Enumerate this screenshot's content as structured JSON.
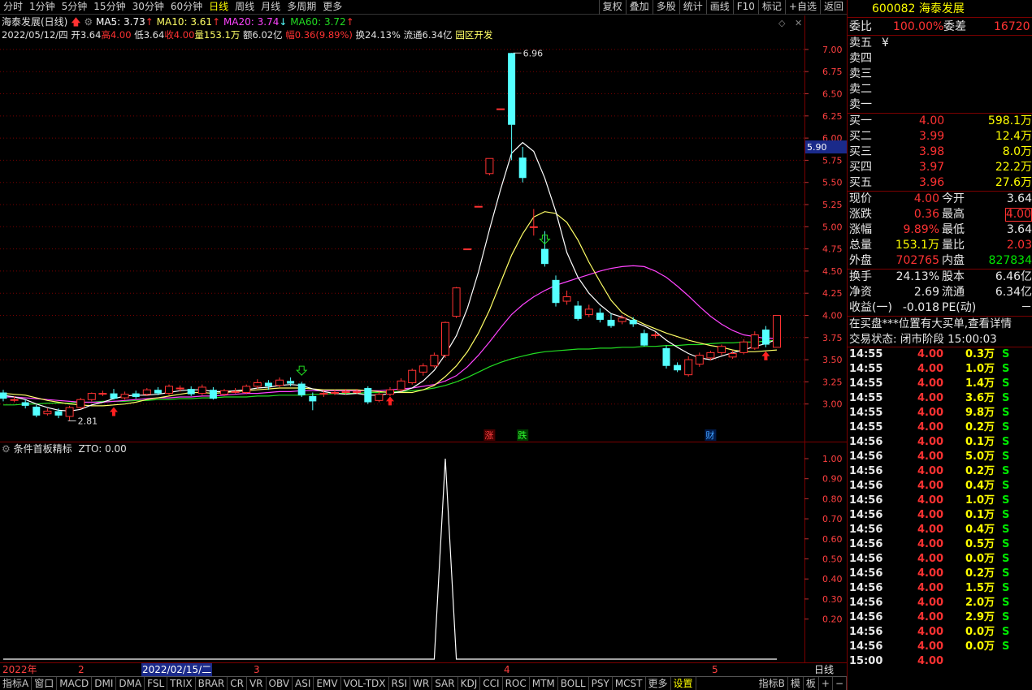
{
  "toolbar": {
    "periods": [
      "分时",
      "1分钟",
      "5分钟",
      "15分钟",
      "30分钟",
      "60分钟",
      "日线",
      "周线",
      "月线",
      "多周期",
      "更多"
    ],
    "active_period": "日线",
    "right_buttons": [
      "复权",
      "叠加",
      "多股",
      "统计",
      "画线",
      "F10",
      "标记",
      "+自选",
      "返回"
    ]
  },
  "header": {
    "title": "海泰发展(日线)",
    "ma5": "MA5: 3.73",
    "ma10": "MA10: 3.61",
    "ma20": "MA20: 3.74",
    "ma60": "MA60: 3.72",
    "date": "2022/05/12/四",
    "open": "开3.64",
    "high": "高4.00",
    "low": "低3.64",
    "close": "收4.00",
    "volume": "量153.1万",
    "amount": "额6.02亿",
    "change": "幅0.36(9.89%)",
    "turnover": "换24.13%",
    "float": "流通6.34亿",
    "sector": "园区开发"
  },
  "colors": {
    "up": "#ff3232",
    "down": "#54ffff",
    "ma5": "#ffffff",
    "ma10": "#ffff66",
    "ma20": "#ff44ff",
    "ma60": "#22dd22",
    "grid": "#7a0000"
  },
  "price_axis": {
    "ticks": [
      "7.00",
      "6.75",
      "6.50",
      "6.25",
      "6.00",
      "5.75",
      "5.50",
      "5.25",
      "5.00",
      "4.75",
      "4.50",
      "4.25",
      "4.00",
      "3.75",
      "3.50",
      "3.25",
      "3.00"
    ],
    "cursor_label": "5.90",
    "max_label": "6.96",
    "min_label": "2.81",
    "event_labels": [
      "涨",
      "跌",
      "财"
    ]
  },
  "indicator": {
    "title": "条件首板精标",
    "value": "ZTO: 0.00",
    "ticks": [
      "1.00",
      "0.90",
      "0.80",
      "0.70",
      "0.60",
      "0.50",
      "0.40",
      "0.30",
      "0.20"
    ]
  },
  "date_axis": {
    "labels": [
      "2022年",
      "2",
      "2022/02/15/二",
      "3",
      "4",
      "5"
    ],
    "right_label": "日线"
  },
  "bottom_tabs": [
    "指标A",
    "窗口",
    "MACD",
    "DMI",
    "DMA",
    "FSL",
    "TRIX",
    "BRAR",
    "CR",
    "VR",
    "OBV",
    "ASI",
    "EMV",
    "VOL-TDX",
    "RSI",
    "WR",
    "SAR",
    "KDJ",
    "CCI",
    "ROC",
    "MTM",
    "BOLL",
    "PSY",
    "MCST",
    "更多",
    "设置"
  ],
  "bottom_right": [
    "指标B",
    "模",
    "板"
  ],
  "quote": {
    "code": "600082",
    "name": "海泰发展",
    "weibi_label": "委比",
    "weibi": "100.00%",
    "weicha_label": "委差",
    "weicha": "16720",
    "sell": [
      {
        "label": "卖五",
        "extra": "¥"
      },
      {
        "label": "卖四",
        "extra": ""
      },
      {
        "label": "卖三",
        "extra": ""
      },
      {
        "label": "卖二",
        "extra": ""
      },
      {
        "label": "卖一",
        "extra": ""
      }
    ],
    "buy": [
      {
        "label": "买一",
        "price": "4.00",
        "vol": "598.1万"
      },
      {
        "label": "买二",
        "price": "3.99",
        "vol": "12.4万"
      },
      {
        "label": "买三",
        "price": "3.98",
        "vol": "8.0万"
      },
      {
        "label": "买四",
        "price": "3.97",
        "vol": "22.2万"
      },
      {
        "label": "买五",
        "price": "3.96",
        "vol": "27.6万"
      }
    ],
    "stats": [
      {
        "l1": "现价",
        "v1": "4.00",
        "l2": "今开",
        "v2": "3.64"
      },
      {
        "l1": "涨跌",
        "v1": "0.36",
        "l2": "最高",
        "v2": "4.00"
      },
      {
        "l1": "涨幅",
        "v1": "9.89%",
        "l2": "最低",
        "v2": "3.64"
      },
      {
        "l1": "总量",
        "v1": "153.1万",
        "l2": "量比",
        "v2": "2.03"
      },
      {
        "l1": "外盘",
        "v1": "702765",
        "l2": "内盘",
        "v2": "827834"
      }
    ],
    "stats2": [
      {
        "l1": "换手",
        "v1": "24.13%",
        "l2": "股本",
        "v2": "6.46亿"
      },
      {
        "l1": "净资",
        "v1": "2.69",
        "l2": "流通",
        "v2": "6.34亿"
      },
      {
        "l1": "收益(一)",
        "v1": "-0.018",
        "l2": "PE(动)",
        "v2": "－"
      }
    ],
    "notice": "在买盘***位置有大买单,查看详情",
    "status": "交易状态: 闭市阶段 15:00:03",
    "ticks": [
      {
        "t": "14:55",
        "p": "4.00",
        "v": "0.3万",
        "s": "S"
      },
      {
        "t": "14:55",
        "p": "4.00",
        "v": "1.0万",
        "s": "S"
      },
      {
        "t": "14:55",
        "p": "4.00",
        "v": "1.4万",
        "s": "S"
      },
      {
        "t": "14:55",
        "p": "4.00",
        "v": "3.6万",
        "s": "S"
      },
      {
        "t": "14:55",
        "p": "4.00",
        "v": "9.8万",
        "s": "S"
      },
      {
        "t": "14:55",
        "p": "4.00",
        "v": "0.2万",
        "s": "S"
      },
      {
        "t": "14:56",
        "p": "4.00",
        "v": "0.1万",
        "s": "S"
      },
      {
        "t": "14:56",
        "p": "4.00",
        "v": "5.0万",
        "s": "S"
      },
      {
        "t": "14:56",
        "p": "4.00",
        "v": "0.2万",
        "s": "S"
      },
      {
        "t": "14:56",
        "p": "4.00",
        "v": "0.4万",
        "s": "S"
      },
      {
        "t": "14:56",
        "p": "4.00",
        "v": "1.0万",
        "s": "S"
      },
      {
        "t": "14:56",
        "p": "4.00",
        "v": "0.1万",
        "s": "S"
      },
      {
        "t": "14:56",
        "p": "4.00",
        "v": "0.4万",
        "s": "S"
      },
      {
        "t": "14:56",
        "p": "4.00",
        "v": "0.5万",
        "s": "S"
      },
      {
        "t": "14:56",
        "p": "4.00",
        "v": "0.0万",
        "s": "S"
      },
      {
        "t": "14:56",
        "p": "4.00",
        "v": "0.2万",
        "s": "S"
      },
      {
        "t": "14:56",
        "p": "4.00",
        "v": "1.5万",
        "s": "S"
      },
      {
        "t": "14:56",
        "p": "4.00",
        "v": "2.0万",
        "s": "S"
      },
      {
        "t": "14:56",
        "p": "4.00",
        "v": "2.9万",
        "s": "S"
      },
      {
        "t": "14:56",
        "p": "4.00",
        "v": "0.0万",
        "s": "S"
      },
      {
        "t": "14:56",
        "p": "4.00",
        "v": "0.0万",
        "s": "S"
      },
      {
        "t": "15:00",
        "p": "4.00",
        "v": "",
        "s": ""
      }
    ]
  },
  "chart_data": {
    "type": "candlestick",
    "ylim": [
      2.75,
      7.1
    ],
    "candles": [
      {
        "o": 3.13,
        "c": 3.06,
        "h": 3.16,
        "l": 3.03
      },
      {
        "o": 3.05,
        "c": 3.05,
        "h": 3.09,
        "l": 3.02
      },
      {
        "o": 3.02,
        "c": 2.98,
        "h": 3.05,
        "l": 2.95
      },
      {
        "o": 2.97,
        "c": 2.87,
        "h": 2.99,
        "l": 2.85
      },
      {
        "o": 2.89,
        "c": 2.92,
        "h": 2.95,
        "l": 2.87
      },
      {
        "o": 2.92,
        "c": 2.87,
        "h": 2.95,
        "l": 2.84
      },
      {
        "o": 2.86,
        "c": 2.96,
        "h": 2.98,
        "l": 2.81
      },
      {
        "o": 2.96,
        "c": 3.05,
        "h": 3.07,
        "l": 2.94
      },
      {
        "o": 3.05,
        "c": 3.12,
        "h": 3.13,
        "l": 3.03
      },
      {
        "o": 3.12,
        "c": 3.12,
        "h": 3.15,
        "l": 3.09
      },
      {
        "o": 3.12,
        "c": 3.06,
        "h": 3.17,
        "l": 3.05
      },
      {
        "o": 3.07,
        "c": 3.11,
        "h": 3.14,
        "l": 3.05
      },
      {
        "o": 3.12,
        "c": 3.08,
        "h": 3.15,
        "l": 3.06
      },
      {
        "o": 3.11,
        "c": 3.16,
        "h": 3.18,
        "l": 3.09
      },
      {
        "o": 3.16,
        "c": 3.12,
        "h": 3.19,
        "l": 3.1
      },
      {
        "o": 3.12,
        "c": 3.2,
        "h": 3.22,
        "l": 3.1
      },
      {
        "o": 3.18,
        "c": 3.18,
        "h": 3.21,
        "l": 3.14
      },
      {
        "o": 3.17,
        "c": 3.11,
        "h": 3.2,
        "l": 3.09
      },
      {
        "o": 3.12,
        "c": 3.19,
        "h": 3.22,
        "l": 3.1
      },
      {
        "o": 3.16,
        "c": 3.06,
        "h": 3.19,
        "l": 3.05
      },
      {
        "o": 3.11,
        "c": 3.15,
        "h": 3.17,
        "l": 3.09
      },
      {
        "o": 3.14,
        "c": 3.14,
        "h": 3.18,
        "l": 3.12
      },
      {
        "o": 3.13,
        "c": 3.2,
        "h": 3.22,
        "l": 3.11
      },
      {
        "o": 3.2,
        "c": 3.24,
        "h": 3.28,
        "l": 3.17
      },
      {
        "o": 3.24,
        "c": 3.2,
        "h": 3.27,
        "l": 3.16
      },
      {
        "o": 3.21,
        "c": 3.27,
        "h": 3.3,
        "l": 3.19
      },
      {
        "o": 3.26,
        "c": 3.23,
        "h": 3.3,
        "l": 3.2
      },
      {
        "o": 3.23,
        "c": 3.1,
        "h": 3.25,
        "l": 3.08
      },
      {
        "o": 3.09,
        "c": 3.03,
        "h": 3.13,
        "l": 2.93
      },
      {
        "o": 3.11,
        "c": 3.12,
        "h": 3.15,
        "l": 3.08
      },
      {
        "o": 3.13,
        "c": 3.13,
        "h": 3.16,
        "l": 3.1
      },
      {
        "o": 3.13,
        "c": 3.14,
        "h": 3.17,
        "l": 3.11
      },
      {
        "o": 3.13,
        "c": 3.14,
        "h": 3.17,
        "l": 3.11
      },
      {
        "o": 3.18,
        "c": 3.02,
        "h": 3.2,
        "l": 3.0
      },
      {
        "o": 3.04,
        "c": 3.11,
        "h": 3.14,
        "l": 3.02
      },
      {
        "o": 3.11,
        "c": 3.16,
        "h": 3.19,
        "l": 3.09
      },
      {
        "o": 3.16,
        "c": 3.26,
        "h": 3.29,
        "l": 3.14
      },
      {
        "o": 3.24,
        "c": 3.38,
        "h": 3.4,
        "l": 3.22
      },
      {
        "o": 3.36,
        "c": 3.43,
        "h": 3.46,
        "l": 3.32
      },
      {
        "o": 3.43,
        "c": 3.55,
        "h": 3.58,
        "l": 3.41
      },
      {
        "o": 3.55,
        "c": 3.92,
        "h": 3.93,
        "l": 3.52
      },
      {
        "o": 3.99,
        "c": 4.31,
        "h": 4.32,
        "l": 3.97
      },
      {
        "o": 4.75,
        "c": 4.75,
        "h": 4.75,
        "l": 4.75
      },
      {
        "o": 5.23,
        "c": 5.23,
        "h": 5.23,
        "l": 5.23
      },
      {
        "o": 5.6,
        "c": 5.77,
        "h": 5.77,
        "l": 5.58
      },
      {
        "o": 6.33,
        "c": 6.33,
        "h": 6.33,
        "l": 6.33
      },
      {
        "o": 6.96,
        "c": 6.15,
        "h": 6.96,
        "l": 5.75
      },
      {
        "o": 5.78,
        "c": 5.55,
        "h": 5.9,
        "l": 5.5
      },
      {
        "o": 5.0,
        "c": 5.0,
        "h": 5.2,
        "l": 4.9
      },
      {
        "o": 4.75,
        "c": 4.58,
        "h": 4.95,
        "l": 4.55
      },
      {
        "o": 4.4,
        "c": 4.14,
        "h": 4.45,
        "l": 4.1
      },
      {
        "o": 4.16,
        "c": 4.21,
        "h": 4.28,
        "l": 4.12
      },
      {
        "o": 4.11,
        "c": 3.96,
        "h": 4.16,
        "l": 3.94
      },
      {
        "o": 4.01,
        "c": 4.07,
        "h": 4.12,
        "l": 3.98
      },
      {
        "o": 4.03,
        "c": 3.95,
        "h": 4.08,
        "l": 3.92
      },
      {
        "o": 3.95,
        "c": 3.88,
        "h": 4.02,
        "l": 3.86
      },
      {
        "o": 3.93,
        "c": 3.97,
        "h": 4.0,
        "l": 3.9
      },
      {
        "o": 3.95,
        "c": 3.9,
        "h": 3.98,
        "l": 3.87
      },
      {
        "o": 3.8,
        "c": 3.66,
        "h": 3.84,
        "l": 3.65
      },
      {
        "o": 3.78,
        "c": 3.78,
        "h": 3.81,
        "l": 3.74
      },
      {
        "o": 3.63,
        "c": 3.43,
        "h": 3.66,
        "l": 3.4
      },
      {
        "o": 3.44,
        "c": 3.38,
        "h": 3.47,
        "l": 3.36
      },
      {
        "o": 3.33,
        "c": 3.5,
        "h": 3.54,
        "l": 3.31
      },
      {
        "o": 3.45,
        "c": 3.55,
        "h": 3.58,
        "l": 3.42
      },
      {
        "o": 3.52,
        "c": 3.58,
        "h": 3.6,
        "l": 3.49
      },
      {
        "o": 3.58,
        "c": 3.65,
        "h": 3.67,
        "l": 3.55
      },
      {
        "o": 3.53,
        "c": 3.57,
        "h": 3.6,
        "l": 3.51
      },
      {
        "o": 3.58,
        "c": 3.7,
        "h": 3.73,
        "l": 3.56
      },
      {
        "o": 3.63,
        "c": 3.78,
        "h": 3.82,
        "l": 3.61
      },
      {
        "o": 3.84,
        "c": 3.67,
        "h": 3.88,
        "l": 3.64
      },
      {
        "o": 3.64,
        "c": 4.0,
        "h": 4.0,
        "l": 3.64
      }
    ],
    "ma5": [
      3.1,
      3.08,
      3.05,
      3.0,
      2.96,
      2.93,
      2.92,
      2.94,
      2.99,
      3.02,
      3.06,
      3.09,
      3.1,
      3.1,
      3.11,
      3.13,
      3.15,
      3.16,
      3.16,
      3.14,
      3.14,
      3.15,
      3.16,
      3.18,
      3.19,
      3.21,
      3.22,
      3.21,
      3.17,
      3.14,
      3.12,
      3.11,
      3.12,
      3.1,
      3.1,
      3.12,
      3.14,
      3.18,
      3.26,
      3.38,
      3.56,
      3.77,
      4.08,
      4.49,
      4.97,
      5.42,
      5.83,
      5.95,
      5.85,
      5.55,
      5.17,
      4.71,
      4.43,
      4.25,
      4.12,
      4.02,
      3.98,
      3.93,
      3.88,
      3.82,
      3.72,
      3.64,
      3.57,
      3.52,
      3.5,
      3.54,
      3.58,
      3.61,
      3.65,
      3.68,
      3.73
    ],
    "ma10": [
      3.12,
      3.11,
      3.1,
      3.07,
      3.04,
      3.02,
      3.0,
      2.99,
      2.98,
      2.98,
      2.99,
      3.0,
      3.02,
      3.05,
      3.07,
      3.09,
      3.11,
      3.13,
      3.13,
      3.12,
      3.13,
      3.14,
      3.15,
      3.16,
      3.17,
      3.18,
      3.18,
      3.18,
      3.17,
      3.16,
      3.16,
      3.16,
      3.16,
      3.15,
      3.14,
      3.13,
      3.13,
      3.13,
      3.16,
      3.21,
      3.31,
      3.43,
      3.59,
      3.8,
      4.06,
      4.37,
      4.68,
      4.92,
      5.11,
      5.17,
      5.15,
      5.05,
      4.85,
      4.6,
      4.38,
      4.17,
      4.03,
      3.96,
      3.9,
      3.85,
      3.8,
      3.76,
      3.72,
      3.69,
      3.66,
      3.64,
      3.61,
      3.59,
      3.59,
      3.6,
      3.61
    ],
    "ma20": [
      3.08,
      3.08,
      3.07,
      3.06,
      3.05,
      3.04,
      3.03,
      3.02,
      3.02,
      3.02,
      3.03,
      3.04,
      3.05,
      3.06,
      3.07,
      3.07,
      3.08,
      3.08,
      3.09,
      3.09,
      3.1,
      3.11,
      3.12,
      3.12,
      3.13,
      3.14,
      3.14,
      3.15,
      3.15,
      3.15,
      3.15,
      3.15,
      3.15,
      3.15,
      3.15,
      3.16,
      3.17,
      3.18,
      3.2,
      3.22,
      3.26,
      3.32,
      3.42,
      3.55,
      3.7,
      3.86,
      4.01,
      4.12,
      4.21,
      4.28,
      4.34,
      4.38,
      4.42,
      4.46,
      4.5,
      4.53,
      4.55,
      4.56,
      4.55,
      4.5,
      4.43,
      4.33,
      4.22,
      4.1,
      3.99,
      3.9,
      3.83,
      3.78,
      3.76,
      3.74,
      3.74
    ],
    "ma60": [
      2.99,
      2.99,
      3.0,
      3.0,
      3.01,
      3.01,
      3.01,
      3.02,
      3.02,
      3.03,
      3.03,
      3.03,
      3.04,
      3.04,
      3.05,
      3.05,
      3.06,
      3.06,
      3.07,
      3.07,
      3.08,
      3.08,
      3.08,
      3.09,
      3.09,
      3.1,
      3.1,
      3.1,
      3.11,
      3.11,
      3.12,
      3.12,
      3.12,
      3.13,
      3.13,
      3.14,
      3.14,
      3.15,
      3.16,
      3.18,
      3.21,
      3.25,
      3.3,
      3.36,
      3.42,
      3.47,
      3.51,
      3.54,
      3.57,
      3.59,
      3.6,
      3.61,
      3.62,
      3.62,
      3.63,
      3.63,
      3.64,
      3.64,
      3.65,
      3.65,
      3.66,
      3.66,
      3.67,
      3.67,
      3.68,
      3.69,
      3.69,
      3.7,
      3.7,
      3.71,
      3.72
    ],
    "indicator": {
      "name": "ZTO",
      "ylim": [
        0,
        1
      ],
      "spike_index": 40,
      "spike_value": 1.0
    }
  }
}
